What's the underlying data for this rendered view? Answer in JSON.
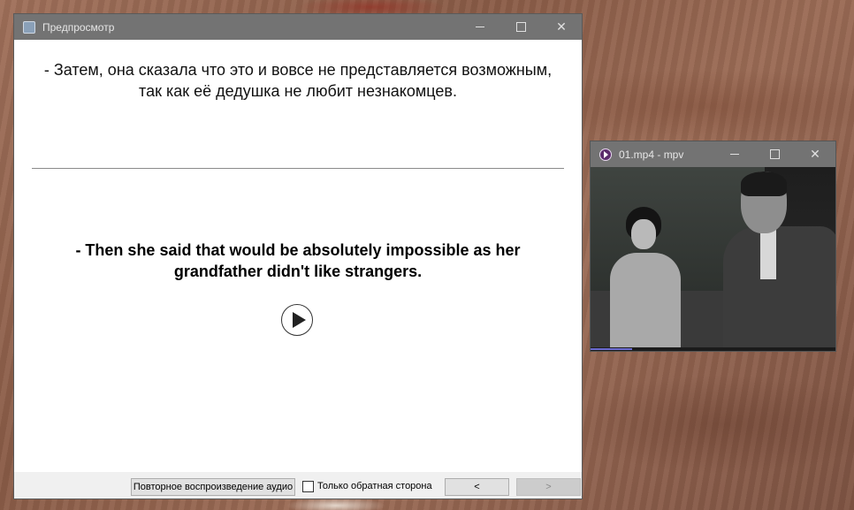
{
  "preview_window": {
    "title": "Предпросмотр",
    "front_text": "- Затем, она сказала что это и вовсе не представляется возможным, так как её дедушка не любит незнакомцев.",
    "back_text": "- Then she said that would be absolutely impossible as her grandfather didn't like strangers.",
    "replay_button": "Повторное воспроизведение аудио",
    "back_only_label": "Только обратная сторона",
    "back_only_checked": false,
    "prev_button": "<",
    "next_button": ">"
  },
  "mpv_window": {
    "title": "01.mp4 - mpv",
    "progress": 0.17
  },
  "window_controls": {
    "minimize": "—",
    "maximize": "☐",
    "close": "✕"
  },
  "colors": {
    "titlebar": "#737373",
    "mpv_progress": "#6b6bd0"
  }
}
